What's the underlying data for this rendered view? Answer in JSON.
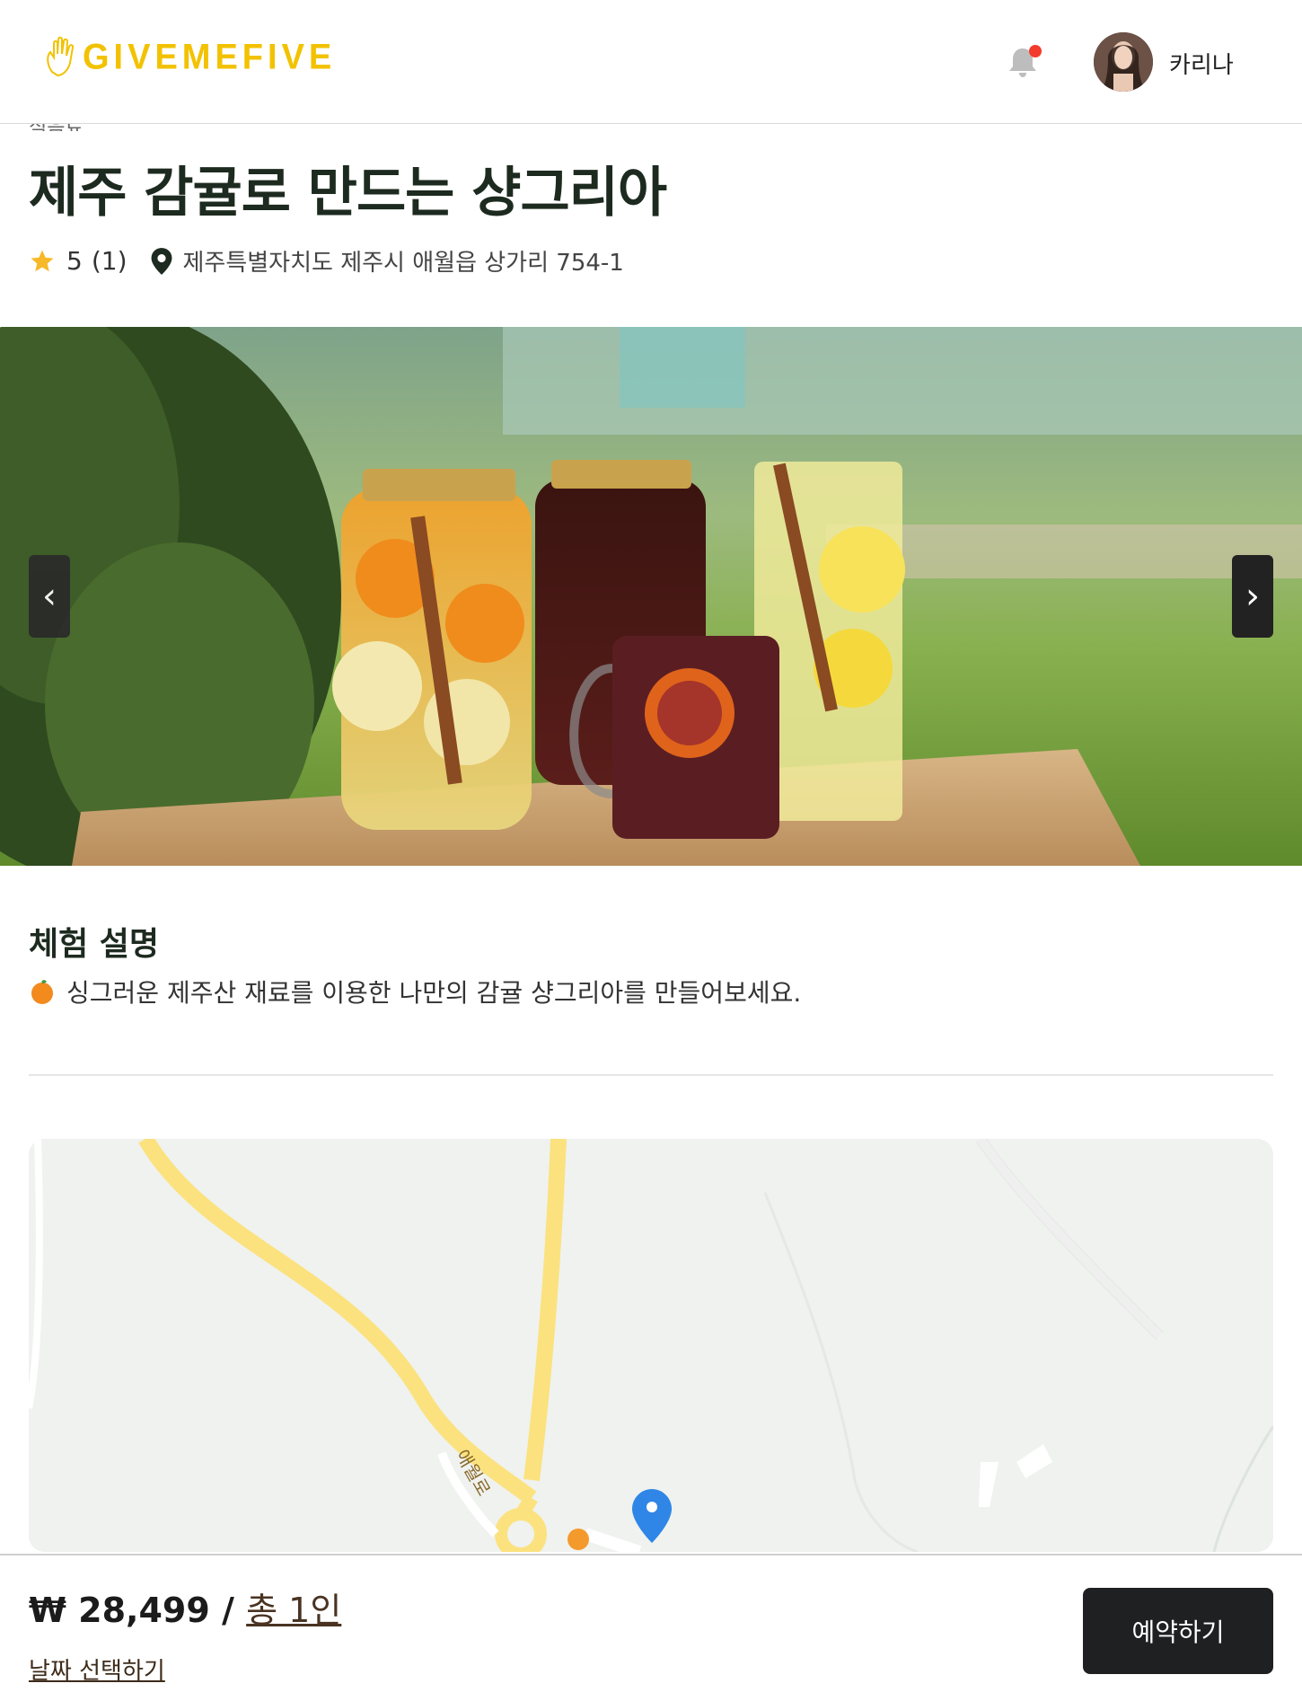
{
  "header": {
    "logo_text": "GIVEMEFIVE",
    "username": "카리나"
  },
  "product": {
    "category": "식음료",
    "title": "제주 감귤로 만드는 샹그리아",
    "rating": "5",
    "review_count": "(1)",
    "address": "제주특별자치도 제주시 애월읍 상가리 754-1"
  },
  "carousel": {
    "prev_label": "‹",
    "next_label": "›"
  },
  "description": {
    "heading": "체험 설명",
    "text": "싱그러운 제주산 재료를 이용한 나만의 감귤 샹그리아를 만들어보세요."
  },
  "map": {
    "road_label": "애월로"
  },
  "booking": {
    "price": "₩ 28,499 / ",
    "people": "총 1인",
    "date_select": "날짜 선택하기",
    "button": "예약하기"
  },
  "colors": {
    "brand": "#f2c200",
    "notification": "#f23b2c",
    "button_bg": "#1f2022",
    "map_pin": "#2f86e6",
    "road": "#fbe27f"
  }
}
